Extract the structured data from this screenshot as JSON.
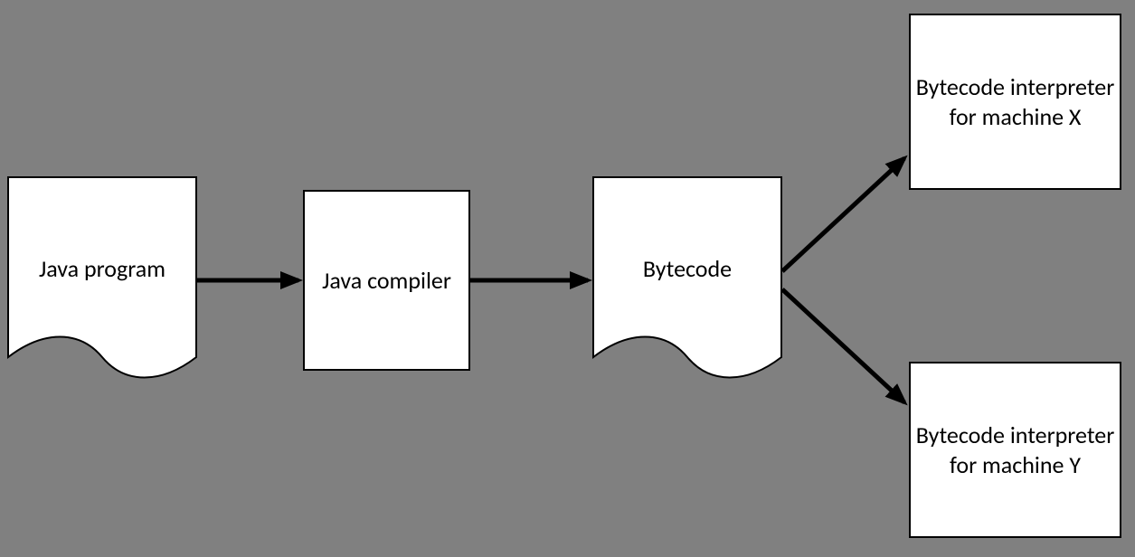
{
  "nodes": {
    "java_program": "Java program",
    "java_compiler": "Java compiler",
    "bytecode": "Bytecode",
    "interpreter_x": "Bytecode interpreter for machine X",
    "interpreter_y": "Bytecode interpreter for machine Y"
  }
}
